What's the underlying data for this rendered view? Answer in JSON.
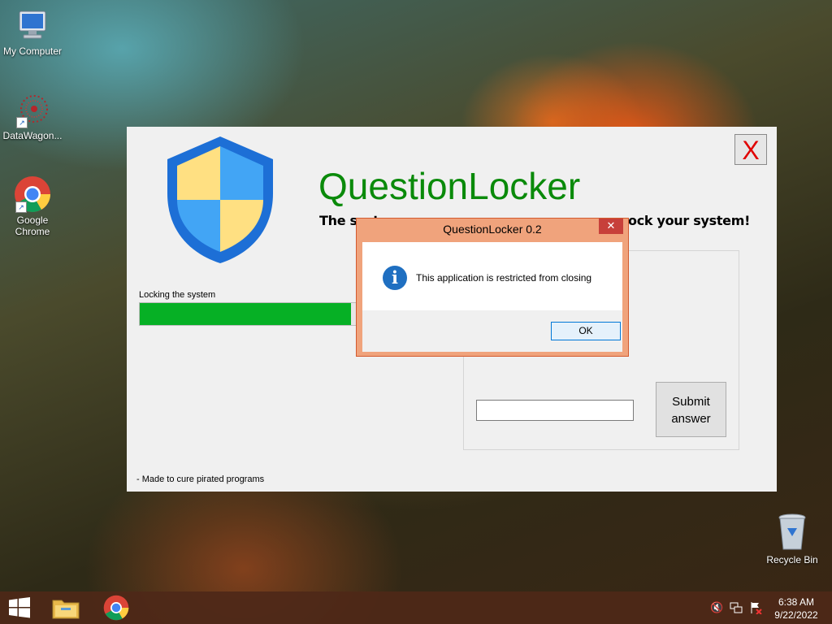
{
  "desktop": {
    "icons": [
      {
        "label": "My Computer"
      },
      {
        "label": "DataWagon..."
      },
      {
        "label": "Google Chrome"
      },
      {
        "label": "Recycle Bin"
      }
    ]
  },
  "app": {
    "close_label": "X",
    "title": "QuestionLocker",
    "subtitle_left": "The syste",
    "subtitle_right": "ock your system!",
    "progress": {
      "label": "Locking the system",
      "value_percent": 67
    },
    "answer_input": {
      "value": "",
      "placeholder": ""
    },
    "submit_label": "Submit answer",
    "footer": "- Made to cure pirated programs",
    "colors": {
      "title": "#0a8a0a",
      "progress": "#06b025",
      "close": "#e00000"
    }
  },
  "dialog": {
    "title": "QuestionLocker 0.2",
    "close_label": "✕",
    "message": "This application is restricted from closing",
    "ok_label": "OK",
    "icon": "info-icon"
  },
  "taskbar": {
    "start_icon": "windows-start-icon",
    "pinned": [
      "file-explorer-icon",
      "chrome-icon"
    ],
    "tray": [
      "volume-muted-icon",
      "network-icon",
      "action-center-flag-icon"
    ],
    "time": "6:38 AM",
    "date": "9/22/2022"
  }
}
